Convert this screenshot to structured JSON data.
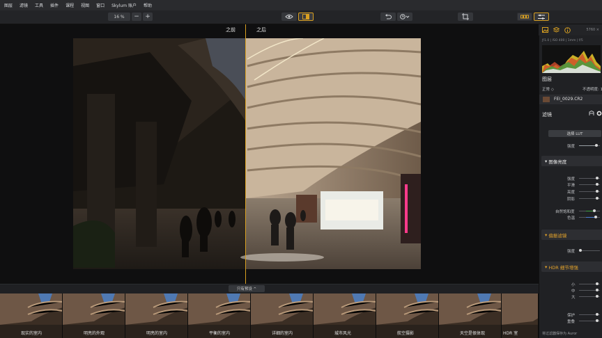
{
  "menu": [
    "图层",
    "滤镜",
    "工具",
    "插件",
    "课程",
    "视图",
    "窗口",
    "Skylum 账户",
    "帮助"
  ],
  "toolbar": {
    "zoom": "16 %",
    "zoom_out": "−",
    "zoom_in": "+"
  },
  "compare": {
    "before": "之前",
    "after": "之后"
  },
  "preview_button": "只有预设 ^",
  "presets": [
    "现实的室内",
    "明亮的外观",
    "明亮的室内",
    "平衡的室内",
    "详细的室内",
    "城市风光",
    "航空摄影",
    "天空是很体现",
    "HDR 室"
  ],
  "panel": {
    "resolution": "5760 ×",
    "exif": "ƒ/1.0  |  ISO 400  |  1mm  |  f/5",
    "layers_title": "图层",
    "blend_mode": "正常 ◇",
    "opacity": "不透明度: 1",
    "layer_name": "FEI_0029.CR2",
    "filters_title": "滤镜",
    "lut_button": "选择 LUT",
    "lut_strength": "强度",
    "image_brightness": {
      "title": "图像亮度",
      "labels": [
        "强度",
        "平滑",
        "亮度",
        "阴影"
      ]
    },
    "natural_sat": "自然饱和度",
    "color_temp": "色温",
    "polarizer": {
      "title": "偏振滤镜",
      "label": "强度"
    },
    "hdr": {
      "title": "HDR 细节增强",
      "labels": [
        "小",
        "中",
        "大",
        "保护",
        "重叠"
      ]
    },
    "footer": "将过滤器保存为 Auror"
  },
  "colors": {
    "accent": "#d9a021",
    "orange_header": "#e4a32a"
  }
}
